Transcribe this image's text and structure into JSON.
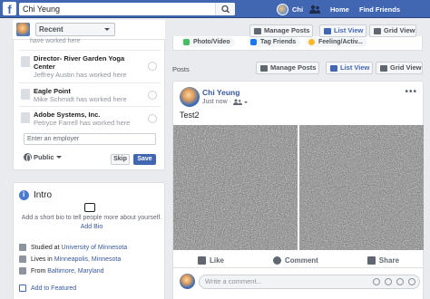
{
  "topbar": {
    "logo": "f",
    "search_value": "Chi Yeung",
    "user_name": "Chi",
    "home_label": "Home",
    "find_friends_label": "Find Friends",
    "brand_color": "#4267b2"
  },
  "left": {
    "recent_select": "Recent",
    "partial_top_text": "have worked here",
    "workplaces": [
      {
        "name": "Director- River Garden Yoga Center",
        "sub": "Jeffrey Austin has worked here"
      },
      {
        "name": "Eagle Point",
        "sub": "Mike Schmidt has worked here"
      },
      {
        "name": "Adobe Systems, Inc.",
        "sub": "Petryce Farrell has worked here"
      }
    ],
    "employer_placeholder": "Enter an employer",
    "privacy_label": "Public",
    "skip_label": "Skip",
    "save_label": "Save"
  },
  "intro": {
    "title": "Intro",
    "bio_prompt": "Add a short bio to tell people more about yourself.",
    "add_bio": "Add Bio",
    "studied_prefix": "Studied at ",
    "studied_link": "University of Minnesota",
    "lives_prefix": "Lives in ",
    "lives_link": "Minneapolis, Minnesota",
    "from_prefix": "From ",
    "from_link": "Baltimore, Maryland",
    "add_featured": "Add to Featured"
  },
  "composer": {
    "tabs": [
      "Photo/Video",
      "Tag Friends",
      "Feeling/Activ..."
    ],
    "tab_icons": [
      "photo-icon",
      "tag-friends-icon",
      "feeling-icon"
    ]
  },
  "toolbar": {
    "manage_posts": "Manage Posts",
    "list_view": "List View",
    "grid_view": "Grid View"
  },
  "posts": {
    "section_label": "Posts",
    "post": {
      "author": "Chi Yeung",
      "time": "Just now ·",
      "text": "Test2",
      "like": "Like",
      "comment": "Comment",
      "share": "Share",
      "comment_placeholder": "Write a comment..."
    }
  }
}
